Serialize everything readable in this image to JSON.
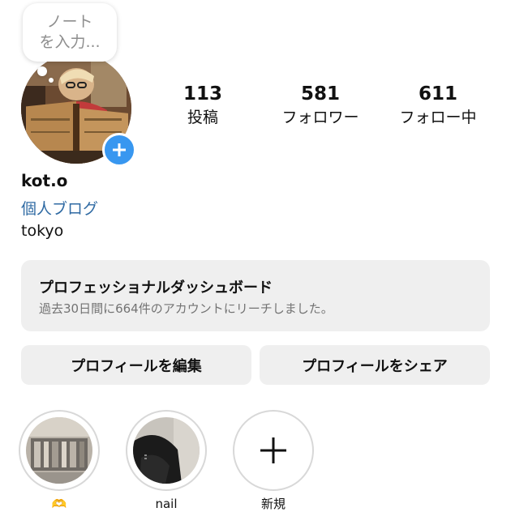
{
  "note": {
    "line1": "ノート",
    "line2": "を入力..."
  },
  "stats": [
    {
      "value": "113",
      "label": "投稿"
    },
    {
      "value": "581",
      "label": "フォロワー"
    },
    {
      "value": "611",
      "label": "フォロー中"
    }
  ],
  "profile": {
    "username": "kot.o",
    "bio_link": "個人ブログ",
    "location": "tokyo"
  },
  "dashboard": {
    "title": "プロフェッショナルダッシュボード",
    "subtitle": "過去30日間に664件のアカウントにリーチしました。"
  },
  "buttons": {
    "edit_profile": "プロフィールを編集",
    "share_profile": "プロフィールをシェア"
  },
  "highlights": [
    {
      "label": "🫶"
    },
    {
      "label": "nail"
    },
    {
      "label": "新規"
    }
  ],
  "colors": {
    "accent_blue": "#3897f0",
    "link_blue": "#2f6aa3",
    "card_gray": "#efefef"
  }
}
